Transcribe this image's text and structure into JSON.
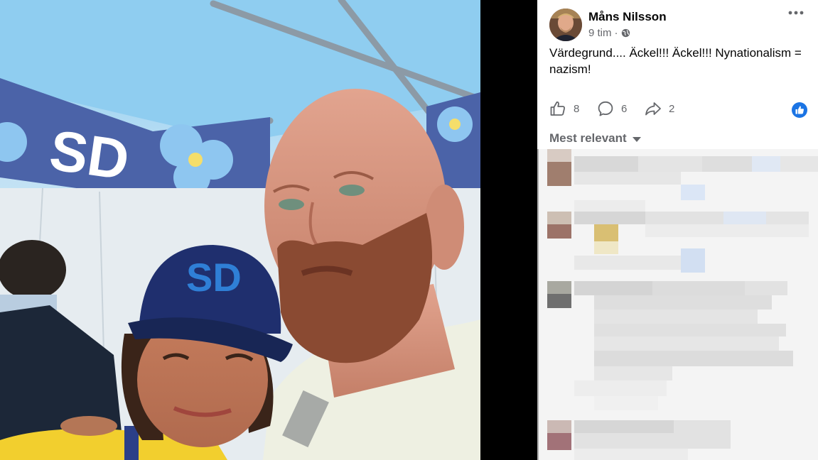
{
  "post": {
    "author": "Måns Nilsson",
    "time": "9 tim",
    "separator": "·",
    "text": "Värdegrund.... Äckel!!! Äckel!!! Nynationalism = nazism!",
    "reactions": {
      "likes": "8",
      "comments": "6",
      "shares": "2"
    },
    "sort_label": "Mest relevant"
  },
  "photo": {
    "cap_text": "SD",
    "tent_text": "SD"
  },
  "icons": {
    "avatar": "profile-photo",
    "privacy": "globe-icon",
    "more": "more-options-icon",
    "like": "thumbs-up-icon",
    "comment": "comment-bubble-icon",
    "share": "share-arrow-icon",
    "reaction_badge": "like-reaction-badge",
    "sort": "caret-down-icon"
  },
  "colors": {
    "accent": "#1b74e4",
    "text": "#050505",
    "secondary": "#65676b"
  }
}
